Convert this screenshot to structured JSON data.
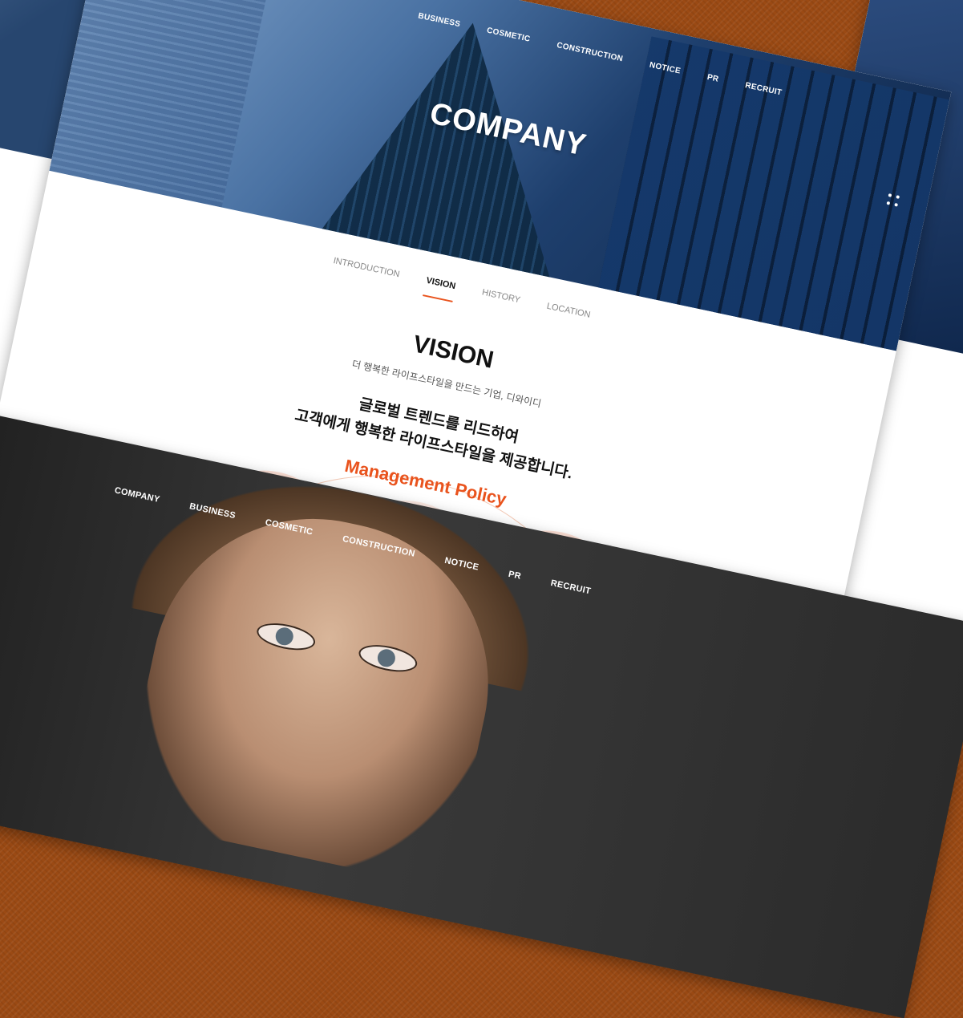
{
  "top_nav": {
    "items": [
      "BUSINESS",
      "COSMETIC",
      "CONSTRUCTION",
      "NOTICE",
      "PR",
      "RECRUIT"
    ]
  },
  "hero": {
    "title": "COMPANY"
  },
  "sub_tabs": {
    "items": [
      {
        "label": "INTRODUCTION",
        "active": false
      },
      {
        "label": "VISION",
        "active": true
      },
      {
        "label": "HISTORY",
        "active": false
      },
      {
        "label": "LOCATION",
        "active": false
      }
    ]
  },
  "vision": {
    "title": "VISION",
    "subtitle": "더 행복한 라이프스타일을 만드는 기업, 디와이디",
    "slogan_line1": "글로벌 트렌드를 리드하여",
    "slogan_line2": "고객에게 행복한 라이프스타일을 제공합니다.",
    "policy_title": "Management Policy"
  },
  "bottom_nav": {
    "items": [
      "COMPANY",
      "BUSINESS",
      "COSMETIC",
      "CONSTRUCTION",
      "NOTICE",
      "PR",
      "RECRUIT"
    ]
  },
  "colors": {
    "accent": "#e9531d",
    "background": "#9b4a14"
  }
}
